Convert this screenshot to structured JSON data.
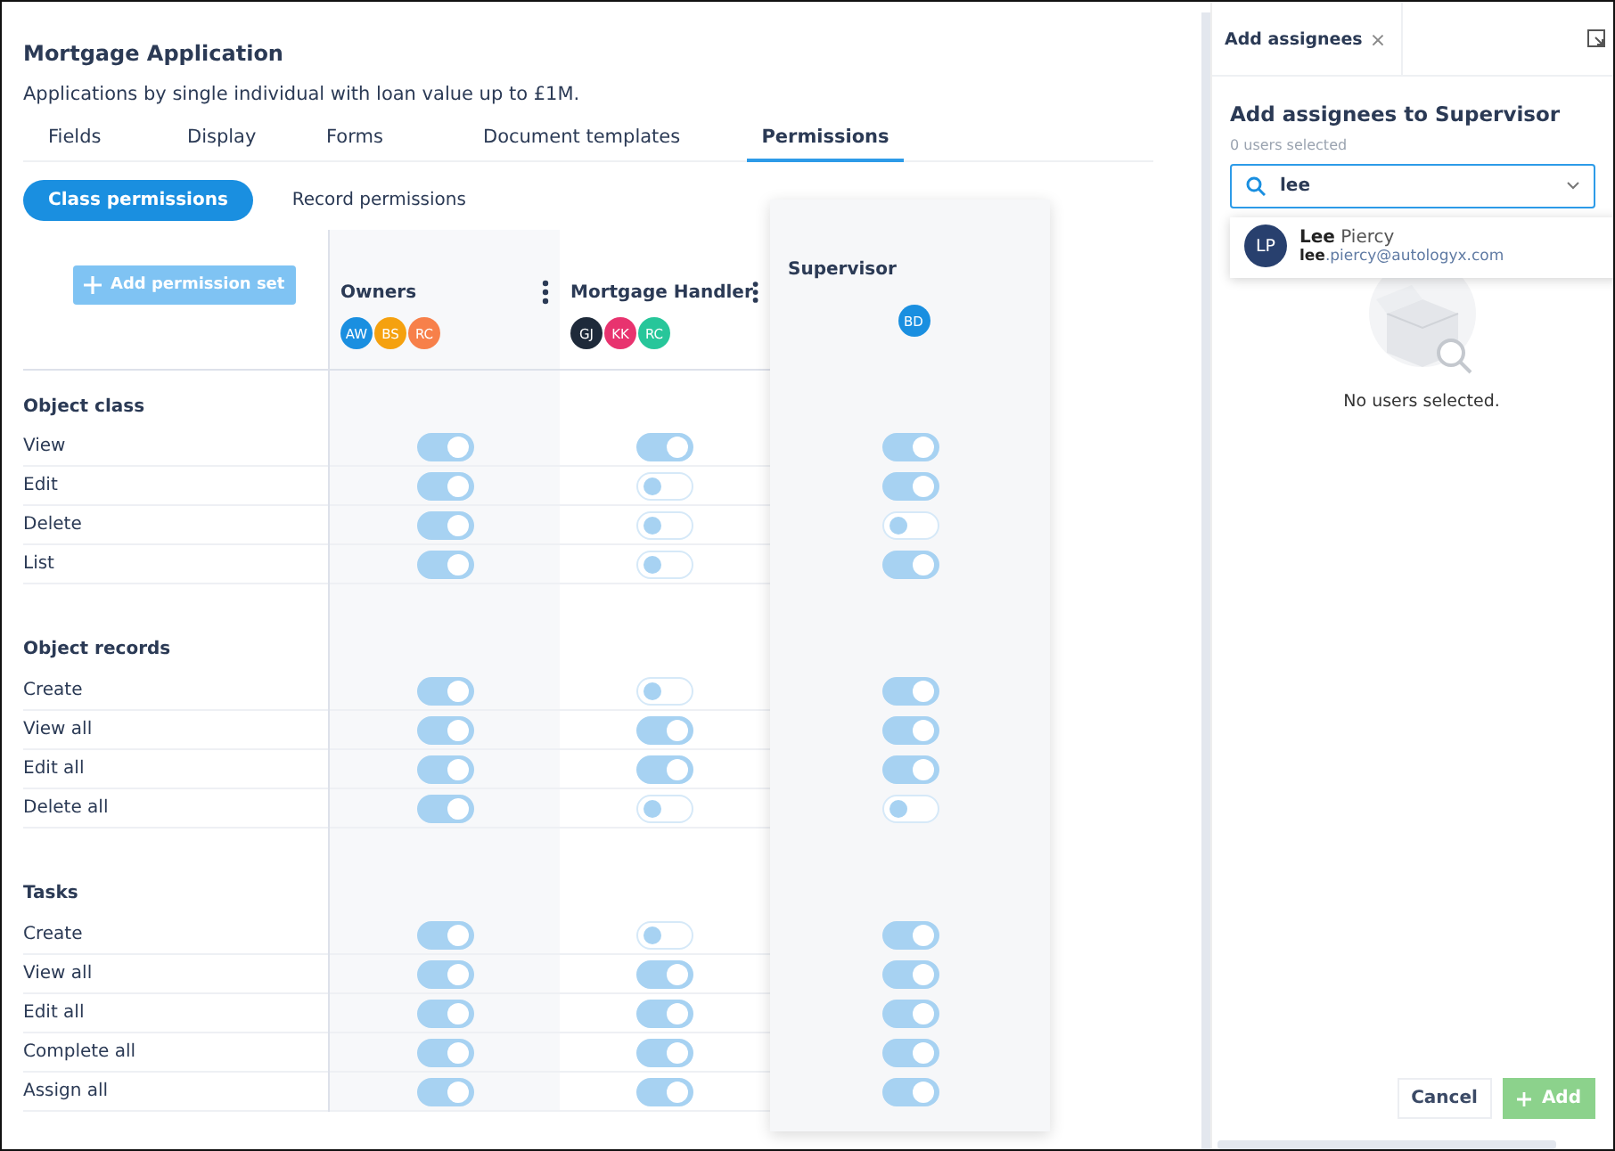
{
  "header": {
    "title": "Mortgage Application",
    "description": "Applications by single individual with loan value up to £1M."
  },
  "tabs": [
    {
      "label": "Fields",
      "selected": false
    },
    {
      "label": "Display",
      "selected": false
    },
    {
      "label": "Forms",
      "selected": false
    },
    {
      "label": "Document templates",
      "selected": false
    },
    {
      "label": "Permissions",
      "selected": true
    }
  ],
  "subtabs": [
    {
      "label": "Class permissions",
      "selected": true
    },
    {
      "label": "Record permissions",
      "selected": false
    }
  ],
  "add_button": "Add permission set",
  "permission_sets": [
    {
      "name": "Owners",
      "has_menu": true,
      "assignees": [
        {
          "initials": "AW",
          "color": "#1a8fe0"
        },
        {
          "initials": "BS",
          "color": "#f5a10f"
        },
        {
          "initials": "RC",
          "color": "#f7804a"
        }
      ]
    },
    {
      "name": "Mortgage Handler",
      "has_menu": true,
      "assignees": [
        {
          "initials": "GJ",
          "color": "#1e2a3a"
        },
        {
          "initials": "KK",
          "color": "#e8336f"
        },
        {
          "initials": "RC",
          "color": "#27c69a"
        }
      ]
    },
    {
      "name": "Supervisor",
      "has_menu": false,
      "assignees": [
        {
          "initials": "BD",
          "color": "#1a8fe0"
        }
      ]
    }
  ],
  "sections": [
    {
      "title": "Object class",
      "rows": [
        {
          "label": "View",
          "on": [
            true,
            true,
            true
          ]
        },
        {
          "label": "Edit",
          "on": [
            true,
            false,
            true
          ]
        },
        {
          "label": "Delete",
          "on": [
            true,
            false,
            false
          ]
        },
        {
          "label": "List",
          "on": [
            true,
            false,
            true
          ]
        }
      ]
    },
    {
      "title": "Object records",
      "rows": [
        {
          "label": "Create",
          "on": [
            true,
            false,
            true
          ]
        },
        {
          "label": "View all",
          "on": [
            true,
            true,
            true
          ]
        },
        {
          "label": "Edit all",
          "on": [
            true,
            true,
            true
          ]
        },
        {
          "label": "Delete all",
          "on": [
            true,
            false,
            false
          ]
        }
      ]
    },
    {
      "title": "Tasks",
      "rows": [
        {
          "label": "Create",
          "on": [
            true,
            false,
            true
          ]
        },
        {
          "label": "View all",
          "on": [
            true,
            true,
            true
          ]
        },
        {
          "label": "Edit all",
          "on": [
            true,
            true,
            true
          ]
        },
        {
          "label": "Complete all",
          "on": [
            true,
            true,
            true
          ]
        },
        {
          "label": "Assign all",
          "on": [
            true,
            true,
            true
          ]
        }
      ]
    }
  ],
  "panel": {
    "tab": "Add assignees",
    "close": "×",
    "title": "Add assignees to Supervisor",
    "selected_count": "0 users selected",
    "search": {
      "value": "lee"
    },
    "results": [
      {
        "initials": "LP",
        "name": "**Lee** Piercy",
        "email": "**lee**.piercy@autologyx.com"
      }
    ],
    "empty_text": "No users selected.",
    "buttons": {
      "cancel": "Cancel",
      "add": "Add"
    }
  }
}
